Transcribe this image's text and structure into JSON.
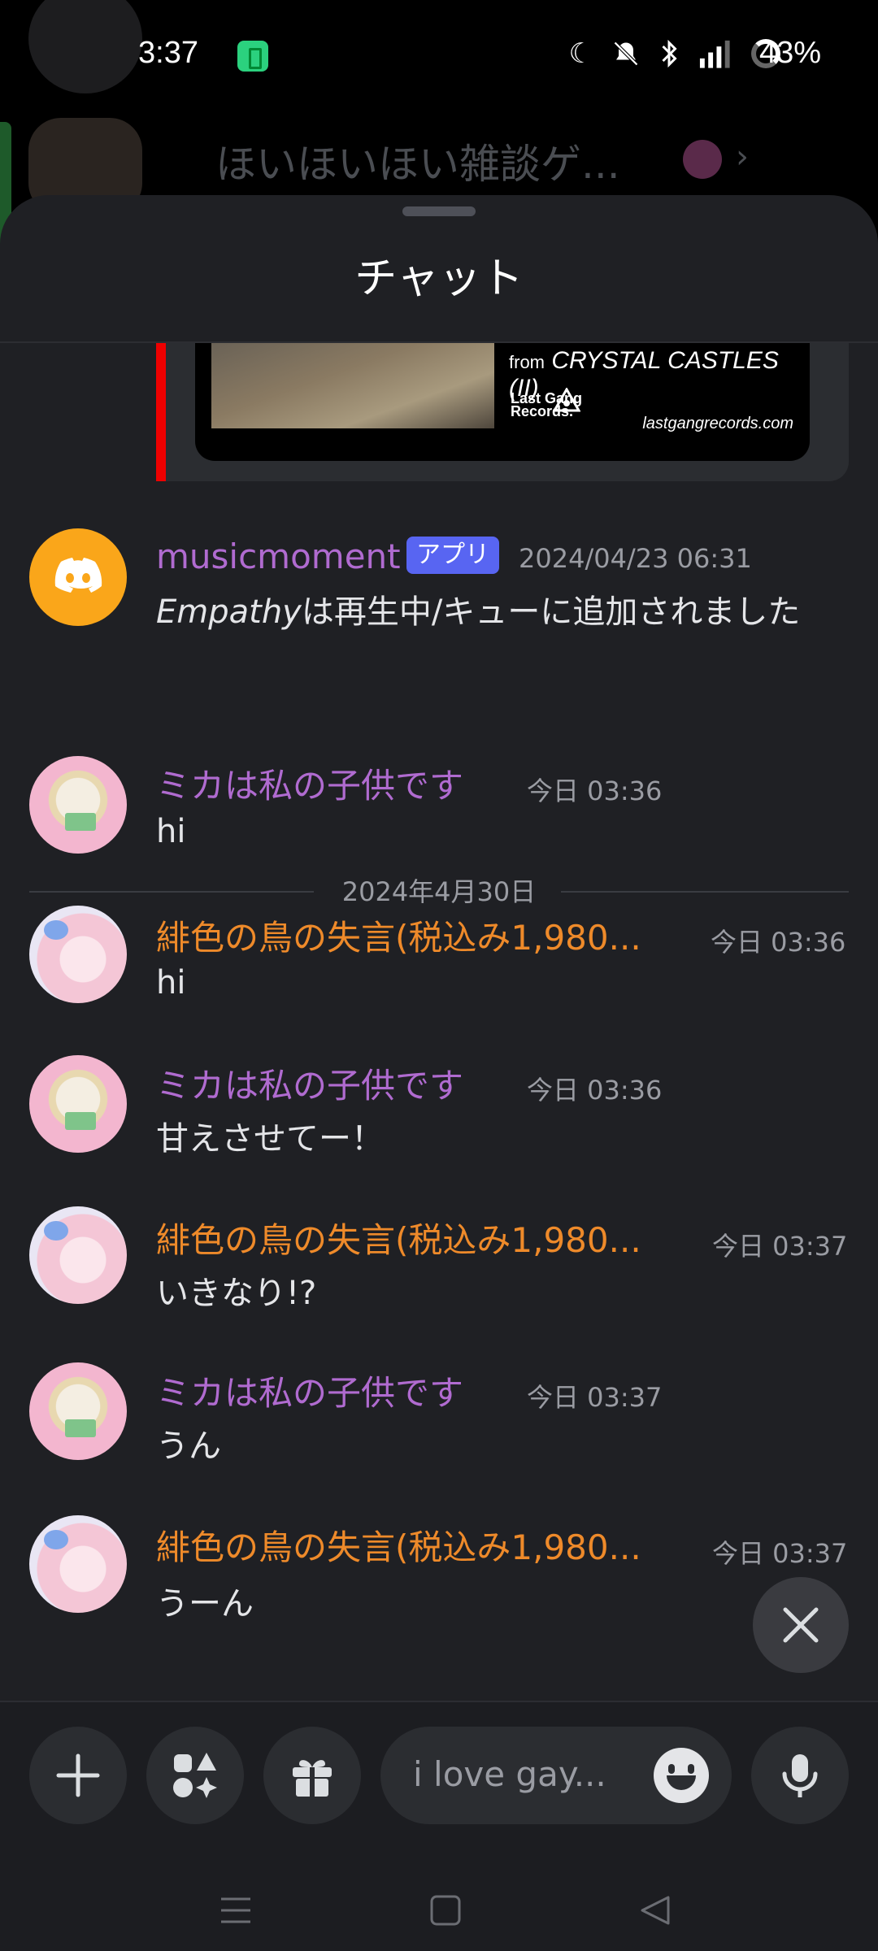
{
  "status": {
    "time": "3:37",
    "battery": "43%",
    "icons": [
      "moon-icon",
      "bell-off-icon",
      "bluetooth-icon",
      "signal-4g-icon"
    ]
  },
  "background": {
    "server_title": "ほいほいほい雑談ゲ..."
  },
  "sheet": {
    "title": "チャット"
  },
  "embed": {
    "from_prefix": "from",
    "album": "CRYSTAL CASTLES (II)",
    "label": "Last Gang Records.",
    "url": "lastgangrecords.com",
    "accent_color": "#ee0000"
  },
  "bot_message": {
    "username": "musicmoment",
    "badge": "アプリ",
    "timestamp": "2024/04/23 06:31",
    "track": "Empathy",
    "text": "は再生中/キューに追加されました"
  },
  "date_divider": "2024年4月30日",
  "messages": [
    {
      "username": "ミカは私の子供です",
      "timestamp": "今日 03:36",
      "content": "hi",
      "avatar": "mika"
    },
    {
      "username": "緋色の鳥の失言(税込み1,980...",
      "timestamp": "今日 03:36",
      "content": "hi",
      "avatar": "hi"
    },
    {
      "username": "ミカは私の子供です",
      "timestamp": "今日 03:36",
      "content": "甘えさせてー！",
      "avatar": "mika"
    },
    {
      "username": "緋色の鳥の失言(税込み1,980...",
      "timestamp": "今日 03:37",
      "content": "いきなり!?",
      "avatar": "hi"
    },
    {
      "username": "ミカは私の子供です",
      "timestamp": "今日 03:37",
      "content": "うん",
      "avatar": "mika"
    },
    {
      "username": "緋色の鳥の失言(税込み1,980...",
      "timestamp": "今日 03:37",
      "content": "うーん",
      "avatar": "hi"
    }
  ],
  "composer": {
    "input_value": "i love gay..."
  },
  "colors": {
    "username_purple": "#b06bd0",
    "username_orange": "#ee8a2a",
    "app_badge": "#5865f2",
    "discord_avatar": "#faa61a"
  }
}
